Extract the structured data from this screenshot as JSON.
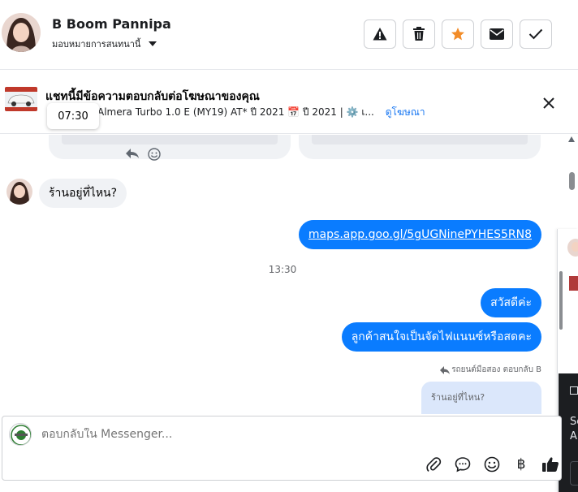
{
  "header": {
    "contact_name": "B Boom Pannipa",
    "assign_label": "มอบหมายการสนทนานี้",
    "actions": [
      {
        "icon": "warning-icon"
      },
      {
        "icon": "trash-icon"
      },
      {
        "icon": "star-icon",
        "color": "#f28c28"
      },
      {
        "icon": "envelope-icon"
      },
      {
        "icon": "check-icon"
      }
    ]
  },
  "ad_banner": {
    "title": "แชทนี้มีข้อความตอบกลับต่อโฆษณาของคุณ",
    "detail": "Almera Turbo 1.0 E (MY19) AT* ปี 2021 📅 ปี 2021 | ⚙️ เ...",
    "link_label": "ดูโฆษณา",
    "tooltip_time": "07:30"
  },
  "messages": {
    "incoming_1": "ร้านอยู่ที่ไหน?",
    "outgoing_link": "maps.app.goo.gl/5gUGNinePYHES5RN8",
    "time_separator": "13:30",
    "outgoing_2": "สวัสดีค่ะ",
    "outgoing_3": "ลูกค้าสนใจเป็นจัดไฟแนนซ์หรือสดคะ",
    "reply_meta": "รถยนต์มือสอง ตอบกลับ B",
    "quoted_text": "ร้านอยู่ที่ไหน?"
  },
  "composer": {
    "placeholder": "ตอบกลับใน Messenger...",
    "tools": [
      "paperclip-icon",
      "chat-bubble-icon",
      "emoji-icon",
      "baht-icon",
      "thumbs-up-icon"
    ],
    "baht_glyph": "฿"
  },
  "side_panel": {
    "line1": "Se",
    "line2": "A"
  },
  "colors": {
    "accent": "#0a7cff",
    "link": "#1877f2",
    "incoming_bubble": "#f0f2f5"
  }
}
